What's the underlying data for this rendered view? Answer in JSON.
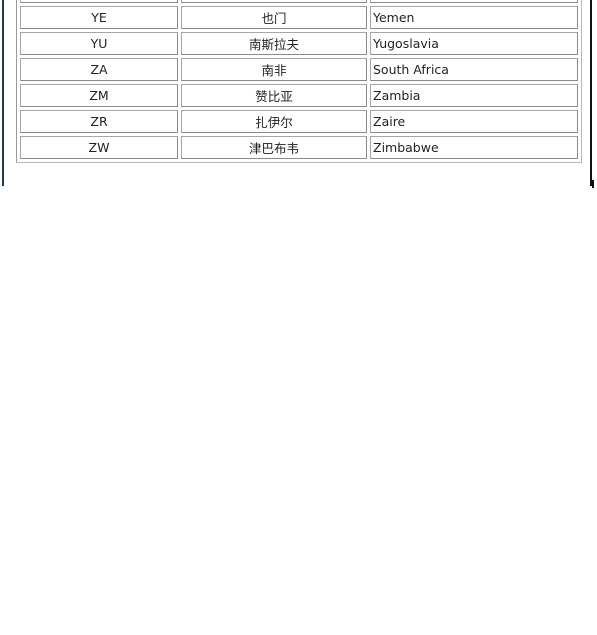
{
  "country_table": {
    "columns": [
      "code",
      "chinese_name",
      "english_name"
    ],
    "rows": [
      {
        "code": "",
        "cn": "",
        "en": ""
      },
      {
        "code": "YE",
        "cn": "也门",
        "en": "Yemen"
      },
      {
        "code": "YU",
        "cn": "南斯拉夫",
        "en": "Yugoslavia"
      },
      {
        "code": "ZA",
        "cn": "南非",
        "en": "South Africa"
      },
      {
        "code": "ZM",
        "cn": "赞比亚",
        "en": "Zambia"
      },
      {
        "code": "ZR",
        "cn": "扎伊尔",
        "en": "Zaire"
      },
      {
        "code": "ZW",
        "cn": "津巴布韦",
        "en": "Zimbabwe"
      }
    ]
  }
}
